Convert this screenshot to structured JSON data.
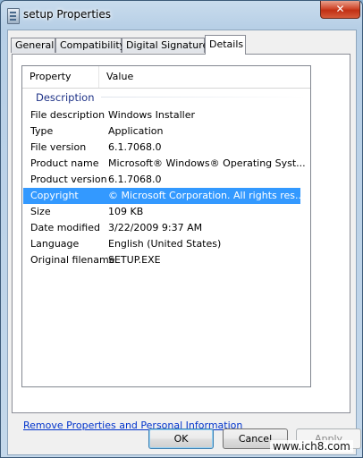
{
  "window": {
    "title": "setup Properties",
    "close_glyph": "✕"
  },
  "tabs": [
    {
      "label": "General"
    },
    {
      "label": "Compatibility"
    },
    {
      "label": "Digital Signatures"
    },
    {
      "label": "Details",
      "active": true
    }
  ],
  "list": {
    "columns": {
      "property": "Property",
      "value": "Value"
    },
    "group": "Description",
    "rows": [
      {
        "k": "File description",
        "v": "Windows Installer"
      },
      {
        "k": "Type",
        "v": "Application"
      },
      {
        "k": "File version",
        "v": "6.1.7068.0"
      },
      {
        "k": "Product name",
        "v": "Microsoft® Windows® Operating Syst..."
      },
      {
        "k": "Product version",
        "v": "6.1.7068.0"
      },
      {
        "k": "Copyright",
        "v": "© Microsoft Corporation. All rights res...",
        "selected": true
      },
      {
        "k": "Size",
        "v": "109 KB"
      },
      {
        "k": "Date modified",
        "v": "3/22/2009 9:37 AM"
      },
      {
        "k": "Language",
        "v": "English (United States)"
      },
      {
        "k": "Original filename",
        "v": "SETUP.EXE"
      }
    ]
  },
  "link": "Remove Properties and Personal Information",
  "buttons": {
    "ok": "OK",
    "cancel": "Cancel",
    "apply": "Apply"
  },
  "watermark": "www.ich8.com",
  "colors": {
    "selection": "#3399ff",
    "group_text": "#1e3287",
    "link": "#0033cc"
  }
}
